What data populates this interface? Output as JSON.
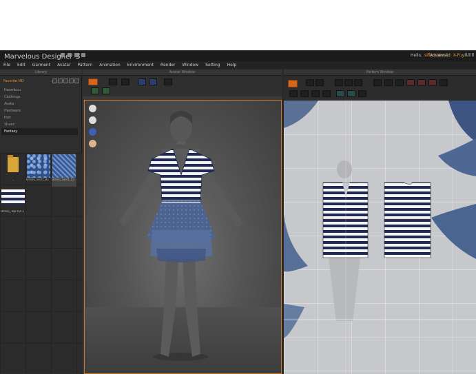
{
  "app": {
    "title": "Marvelous",
    "title_suffix": "Designer",
    "version": "3",
    "user_greeting": "Hello,",
    "username": "siflxorders1",
    "mode_label": "Advanced",
    "mode_value": "X-Fuyis"
  },
  "menu": [
    "File",
    "Edit",
    "Garment",
    "Avatar",
    "Pattern",
    "Animation",
    "Environment",
    "Render",
    "Window",
    "Setting",
    "Help"
  ],
  "panels": {
    "library_title": "Library",
    "avatar_title": "Avatar Window",
    "pattern_title": "Pattern Window"
  },
  "library": {
    "path": "Favorite MD",
    "tree": [
      "Hanmkuu",
      "Clothings",
      "Avata",
      "Hardware",
      "Hair",
      "Shoes",
      "Fantasy"
    ],
    "active_index": 6,
    "thumbnails": [
      {
        "caption": "..",
        "kind": "folder"
      },
      {
        "caption": "Dress_Skirt_01",
        "kind": "fabric-a"
      },
      {
        "caption": "Dress_Skirt_02",
        "kind": "fabric-b"
      },
      {
        "caption": "Dress_Top 02.1",
        "kind": "stripe"
      }
    ]
  },
  "colors": {
    "accent": "#d2681e",
    "viewport_border": "#c8762a",
    "stripe_navy": "#1e2a52",
    "skirt_blue": "#4b6491",
    "pattern_bg": "#c7c8cc"
  }
}
